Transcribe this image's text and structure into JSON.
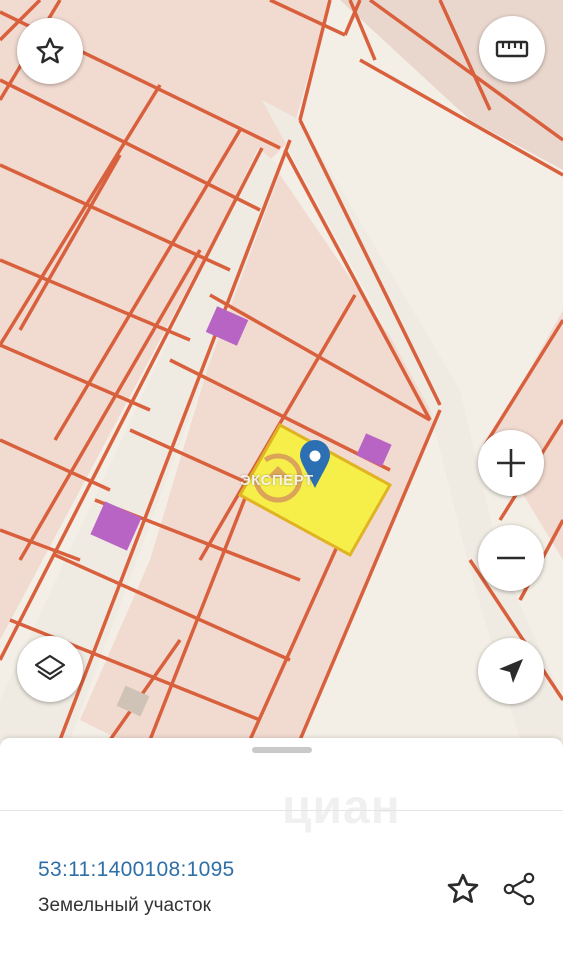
{
  "map": {
    "colors": {
      "background": "#f3efe6",
      "parcel_fill": "#f1dad0",
      "parcel_border": "#d9603c",
      "road": "#efeae2",
      "selected_fill": "#f6ef4a",
      "selected_border": "#e0b323",
      "building": "#b764c4",
      "pin": "#2c6fb3"
    },
    "icons": [
      "star-icon",
      "ruler-icon",
      "zoom-in-icon",
      "zoom-out-icon",
      "layers-icon",
      "location-arrow-icon"
    ],
    "watermark_logo": "ЭКСПЕРТ"
  },
  "sheet": {
    "parcel_id": "53:11:1400108:1095",
    "parcel_type": "Земельный участок",
    "watermark": "циан",
    "icons": [
      "star-outline-icon",
      "share-icon"
    ]
  }
}
